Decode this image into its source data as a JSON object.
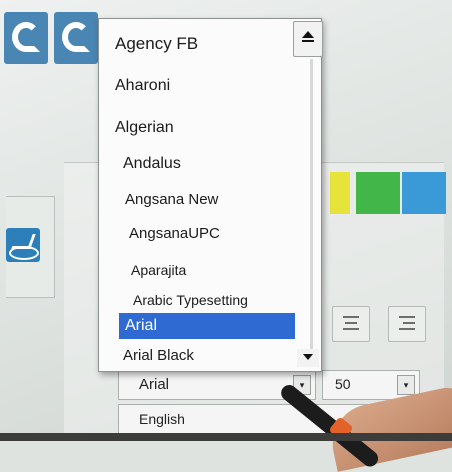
{
  "font_dropdown": {
    "items": [
      "Agency FB",
      "Aharoni",
      "Algerian",
      "Andalus",
      "Angsana New",
      "AngsanaUPC",
      "Aparajita",
      "Arabic Typesetting",
      "Arial",
      "Arial Black"
    ],
    "selected": "Arial"
  },
  "font_select": {
    "value": "Arial"
  },
  "size_spinner": {
    "value": "50"
  },
  "language_select": {
    "value": "English"
  },
  "colors": {
    "selected_highlight": "#2e6ad1",
    "swatch_yellow": "#e6e33a",
    "swatch_green": "#42b649",
    "swatch_blue": "#3a9ad8",
    "ribbon_icon": "#4a86b3"
  },
  "icons": {
    "ribbon": [
      "undo-arrow-icon",
      "redo-arrow-icon"
    ],
    "left_panel": "shape-arrow-icon",
    "align": [
      "align-center-icon",
      "align-right-icon"
    ]
  }
}
